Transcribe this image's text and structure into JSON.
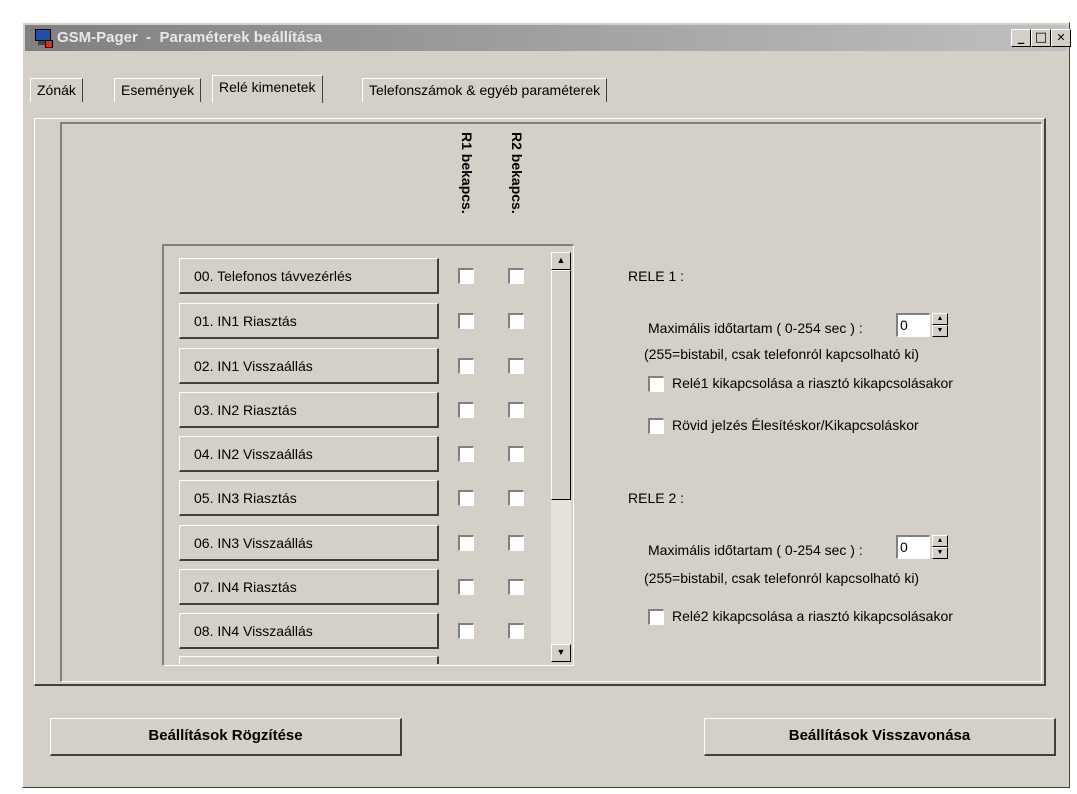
{
  "window": {
    "title": "GSM-Pager  -  Paraméterek beállítása",
    "buttons": {
      "minimize": "_",
      "maximize": "□",
      "close": "✕"
    }
  },
  "tabs": [
    {
      "label": "Zónák",
      "active": false
    },
    {
      "label": "Események",
      "active": false
    },
    {
      "label": "Relé kimenetek",
      "active": true
    },
    {
      "label": "Telefonszámok & egyéb paraméterek",
      "active": false
    }
  ],
  "columns": {
    "r1": "R1 bekapcs.",
    "r2": "R2 bekapcs."
  },
  "events": [
    {
      "label": "00. Telefonos távvezérlés",
      "r1": false,
      "r2": false
    },
    {
      "label": "01. IN1 Riasztás",
      "r1": false,
      "r2": false
    },
    {
      "label": "02. IN1 Visszaállás",
      "r1": false,
      "r2": false
    },
    {
      "label": "03. IN2 Riasztás",
      "r1": false,
      "r2": false
    },
    {
      "label": "04. IN2 Visszaállás",
      "r1": false,
      "r2": false
    },
    {
      "label": "05. IN3 Riasztás",
      "r1": false,
      "r2": false
    },
    {
      "label": "06. IN3 Visszaállás",
      "r1": false,
      "r2": false
    },
    {
      "label": "07. IN4 Riasztás",
      "r1": false,
      "r2": false
    },
    {
      "label": "08. IN4 Visszaállás",
      "r1": false,
      "r2": false
    }
  ],
  "rele1": {
    "heading": "RELE 1 :",
    "duration_label": "Maximális időtartam ( 0-254 sec ) :",
    "duration_value": "0",
    "note": "(255=bistabil, csak telefonról kapcsolható ki)",
    "options": [
      {
        "label": "Relé1 kikapcsolása a riasztó kikapcsolásakor",
        "checked": false
      },
      {
        "label": "Rövid jelzés Élesítéskor/Kikapcsoláskor",
        "checked": false
      }
    ]
  },
  "rele2": {
    "heading": "RELE 2 :",
    "duration_label": "Maximális időtartam ( 0-254 sec ) :",
    "duration_value": "0",
    "note": "(255=bistabil, csak telefonról kapcsolható ki)",
    "options": [
      {
        "label": "Relé2 kikapcsolása a riasztó kikapcsolásakor",
        "checked": false
      }
    ]
  },
  "footer": {
    "save_label": "Beállítások Rögzítése",
    "revert_label": "Beállítások Visszavonása"
  }
}
